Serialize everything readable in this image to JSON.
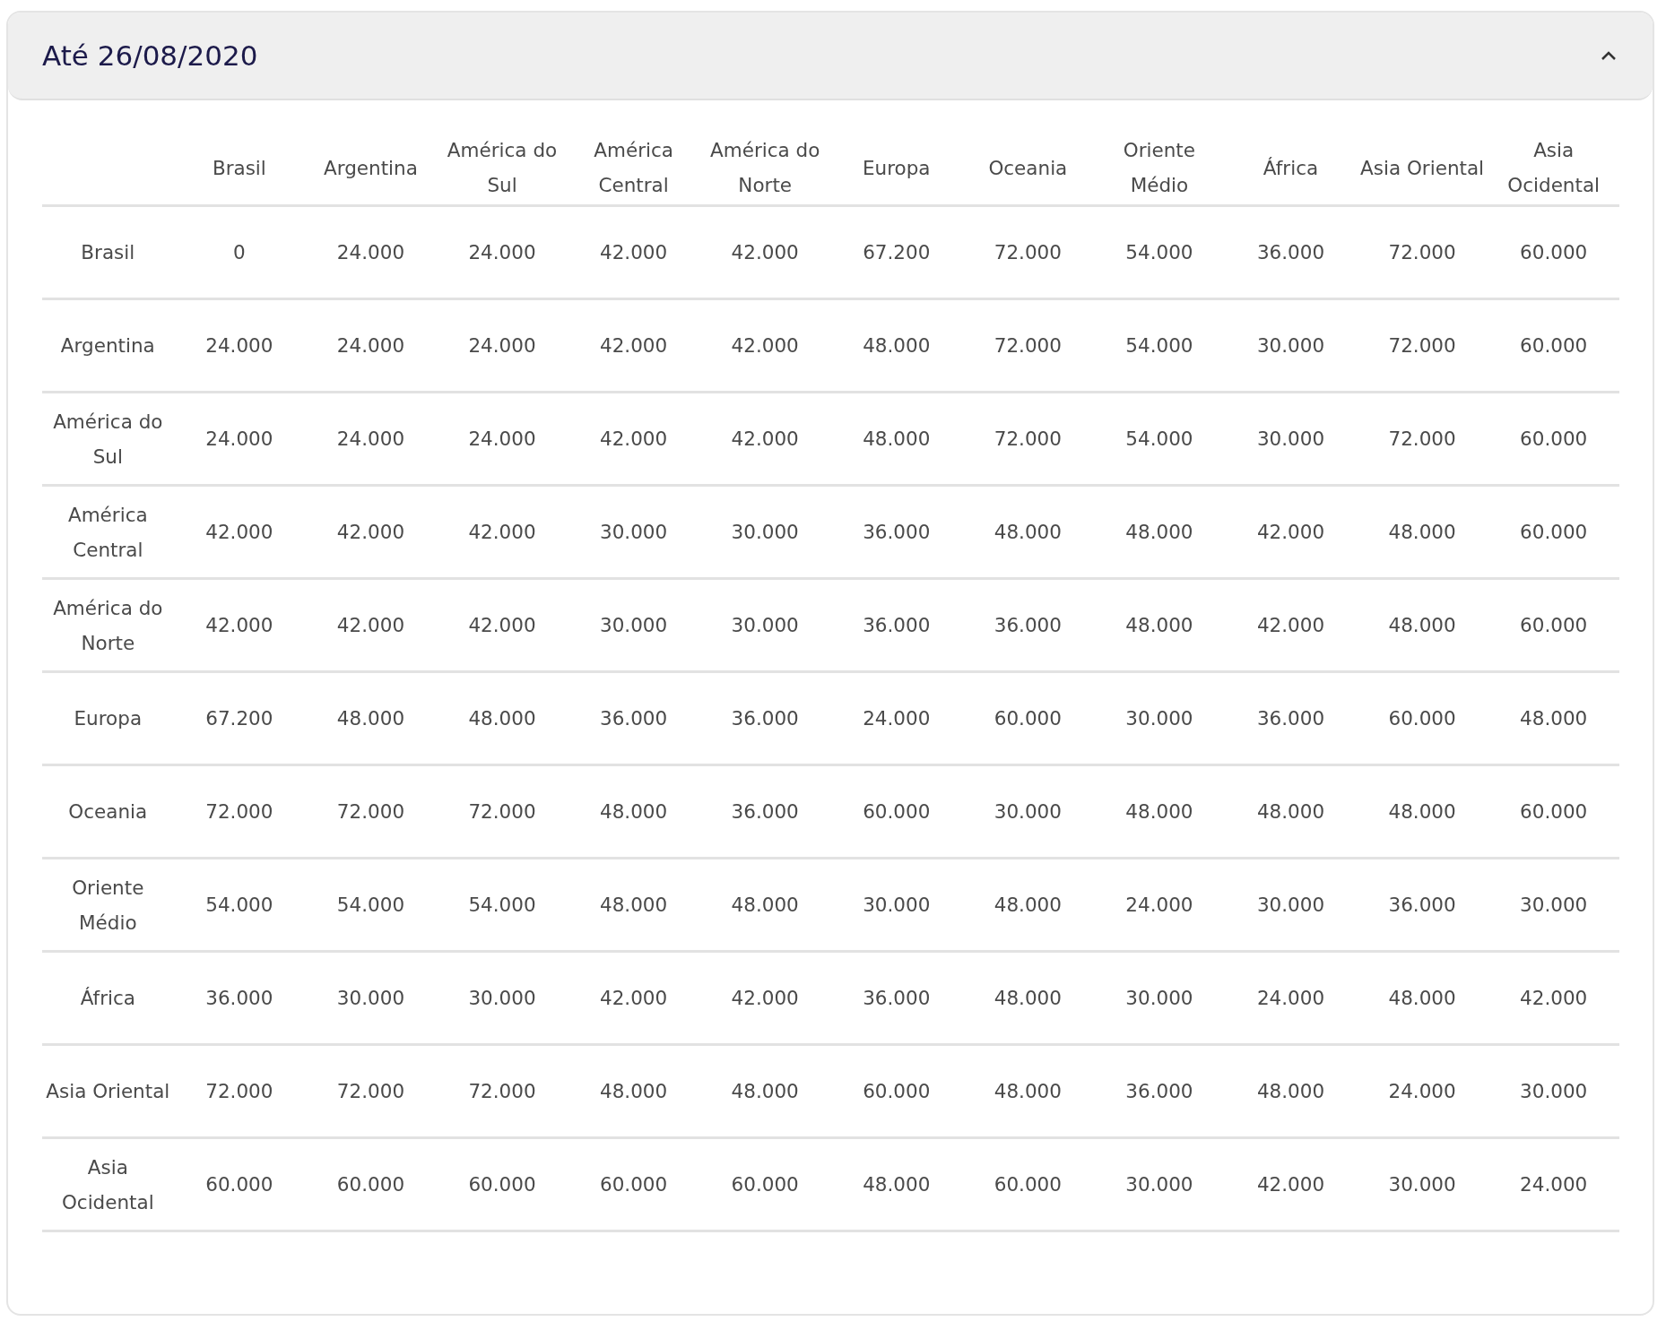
{
  "panel": {
    "title": "Até 26/08/2020",
    "expanded": true
  },
  "table": {
    "columns": [
      "Brasil",
      "Argentina",
      "América do Sul",
      "América Central",
      "América do Norte",
      "Europa",
      "Oceania",
      "Oriente Médio",
      "África",
      "Asia Oriental",
      "Asia Ocidental"
    ],
    "rows": [
      {
        "label": "Brasil",
        "cells": [
          "0",
          "24.000",
          "24.000",
          "42.000",
          "42.000",
          "67.200",
          "72.000",
          "54.000",
          "36.000",
          "72.000",
          "60.000"
        ]
      },
      {
        "label": "Argentina",
        "cells": [
          "24.000",
          "24.000",
          "24.000",
          "42.000",
          "42.000",
          "48.000",
          "72.000",
          "54.000",
          "30.000",
          "72.000",
          "60.000"
        ]
      },
      {
        "label": "América do Sul",
        "cells": [
          "24.000",
          "24.000",
          "24.000",
          "42.000",
          "42.000",
          "48.000",
          "72.000",
          "54.000",
          "30.000",
          "72.000",
          "60.000"
        ]
      },
      {
        "label": "América Central",
        "cells": [
          "42.000",
          "42.000",
          "42.000",
          "30.000",
          "30.000",
          "36.000",
          "48.000",
          "48.000",
          "42.000",
          "48.000",
          "60.000"
        ]
      },
      {
        "label": "América do Norte",
        "cells": [
          "42.000",
          "42.000",
          "42.000",
          "30.000",
          "30.000",
          "36.000",
          "36.000",
          "48.000",
          "42.000",
          "48.000",
          "60.000"
        ]
      },
      {
        "label": "Europa",
        "cells": [
          "67.200",
          "48.000",
          "48.000",
          "36.000",
          "36.000",
          "24.000",
          "60.000",
          "30.000",
          "36.000",
          "60.000",
          "48.000"
        ]
      },
      {
        "label": "Oceania",
        "cells": [
          "72.000",
          "72.000",
          "72.000",
          "48.000",
          "36.000",
          "60.000",
          "30.000",
          "48.000",
          "48.000",
          "48.000",
          "60.000"
        ]
      },
      {
        "label": "Oriente Médio",
        "cells": [
          "54.000",
          "54.000",
          "54.000",
          "48.000",
          "48.000",
          "30.000",
          "48.000",
          "24.000",
          "30.000",
          "36.000",
          "30.000"
        ]
      },
      {
        "label": "África",
        "cells": [
          "36.000",
          "30.000",
          "30.000",
          "42.000",
          "42.000",
          "36.000",
          "48.000",
          "30.000",
          "24.000",
          "48.000",
          "42.000"
        ]
      },
      {
        "label": "Asia Oriental",
        "cells": [
          "72.000",
          "72.000",
          "72.000",
          "48.000",
          "48.000",
          "60.000",
          "48.000",
          "36.000",
          "48.000",
          "24.000",
          "30.000"
        ]
      },
      {
        "label": "Asia Ocidental",
        "cells": [
          "60.000",
          "60.000",
          "60.000",
          "60.000",
          "60.000",
          "48.000",
          "60.000",
          "30.000",
          "42.000",
          "30.000",
          "24.000"
        ]
      }
    ]
  }
}
